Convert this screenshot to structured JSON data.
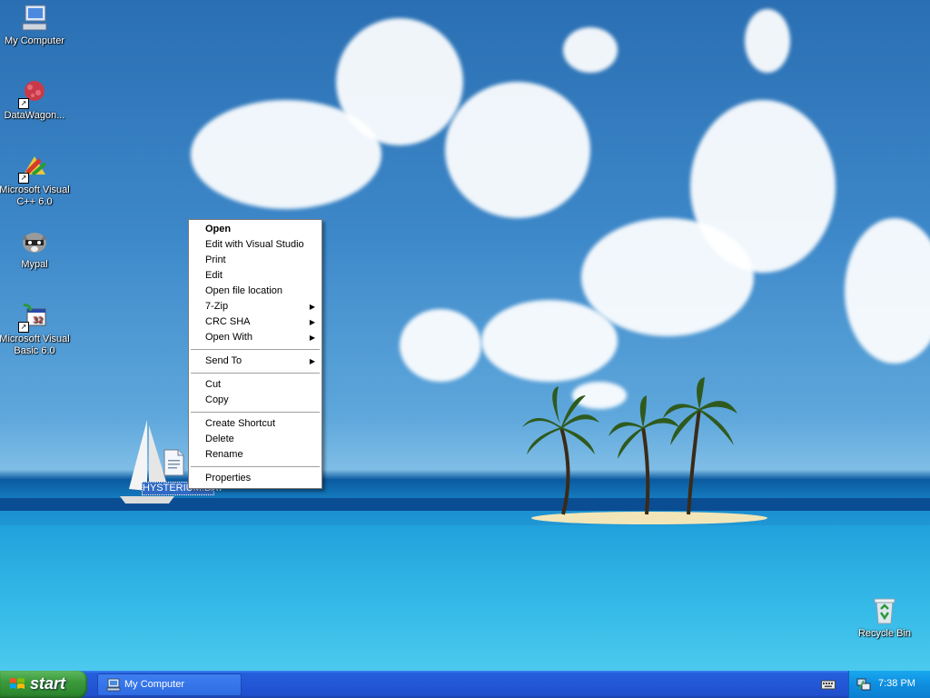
{
  "desktop": {
    "icons": [
      {
        "label": "My Computer",
        "icon": "computer-icon"
      },
      {
        "label": "DataWagon...",
        "icon": "datawagon-icon"
      },
      {
        "label": "Microsoft Visual C++ 6.0",
        "icon": "visual-cpp-icon"
      },
      {
        "label": "Mypal",
        "icon": "mypal-raccoon-icon"
      },
      {
        "label": "Microsoft Visual Basic 6.0",
        "icon": "visual-basic-icon"
      },
      {
        "label": "Recycle Bin",
        "icon": "recycle-bin-icon"
      }
    ],
    "selected_file": {
      "label": "HYSTERIUM.DAT",
      "icon": "file-icon"
    }
  },
  "context_menu": {
    "items": [
      {
        "label": "Open",
        "bold": true
      },
      {
        "label": "Edit with Visual Studio"
      },
      {
        "label": "Print"
      },
      {
        "label": "Edit"
      },
      {
        "label": "Open file location"
      },
      {
        "label": "7-Zip",
        "submenu": true
      },
      {
        "label": "CRC SHA",
        "submenu": true
      },
      {
        "label": "Open With",
        "submenu": true
      },
      {
        "label": "Send To",
        "submenu": true
      },
      {
        "label": "Cut"
      },
      {
        "label": "Copy"
      },
      {
        "label": "Create Shortcut"
      },
      {
        "label": "Delete"
      },
      {
        "label": "Rename"
      },
      {
        "label": "Properties"
      }
    ]
  },
  "taskbar": {
    "start_label": "start",
    "tasks": [
      {
        "label": "My Computer",
        "icon": "computer-icon"
      }
    ],
    "clock": "7:38 PM"
  },
  "colors": {
    "taskbar_blue": "#245edb",
    "start_green": "#3c9a3c",
    "selection_blue": "#316ac5"
  }
}
